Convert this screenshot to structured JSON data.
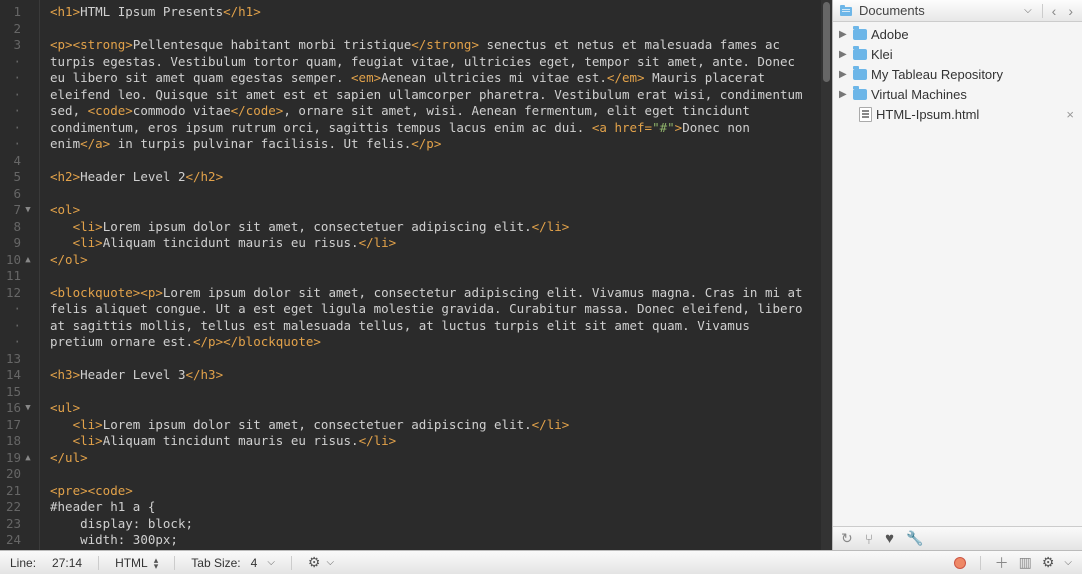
{
  "gutter": [
    {
      "n": "1"
    },
    {
      "n": "2"
    },
    {
      "n": "3"
    },
    {
      "n": "·"
    },
    {
      "n": "·"
    },
    {
      "n": "·"
    },
    {
      "n": "·"
    },
    {
      "n": "·"
    },
    {
      "n": "·"
    },
    {
      "n": "4"
    },
    {
      "n": "5"
    },
    {
      "n": "6"
    },
    {
      "n": "7",
      "mark": "▼"
    },
    {
      "n": "8"
    },
    {
      "n": "9"
    },
    {
      "n": "10",
      "mark": "▲"
    },
    {
      "n": "11"
    },
    {
      "n": "12"
    },
    {
      "n": "·"
    },
    {
      "n": "·"
    },
    {
      "n": "·"
    },
    {
      "n": "13"
    },
    {
      "n": "14"
    },
    {
      "n": "15"
    },
    {
      "n": "16",
      "mark": "▼"
    },
    {
      "n": "17"
    },
    {
      "n": "18"
    },
    {
      "n": "19",
      "mark": "▲"
    },
    {
      "n": "20"
    },
    {
      "n": "21"
    },
    {
      "n": "22"
    },
    {
      "n": "23"
    },
    {
      "n": "24"
    }
  ],
  "code_lines": [
    [
      {
        "c": "tag",
        "t": "<h1>"
      },
      {
        "c": "txt",
        "t": "HTML Ipsum Presents"
      },
      {
        "c": "tag",
        "t": "</h1>"
      }
    ],
    [],
    [
      {
        "c": "tag",
        "t": "<p><strong>"
      },
      {
        "c": "txt",
        "t": "Pellentesque habitant morbi tristique"
      },
      {
        "c": "tag",
        "t": "</strong>"
      },
      {
        "c": "txt",
        "t": " senectus et netus et malesuada fames ac "
      }
    ],
    [
      {
        "c": "txt",
        "t": "turpis egestas. Vestibulum tortor quam, feugiat vitae, ultricies eget, tempor sit amet, ante. Donec "
      }
    ],
    [
      {
        "c": "txt",
        "t": "eu libero sit amet quam egestas semper. "
      },
      {
        "c": "tag",
        "t": "<em>"
      },
      {
        "c": "txt",
        "t": "Aenean ultricies mi vitae est."
      },
      {
        "c": "tag",
        "t": "</em>"
      },
      {
        "c": "txt",
        "t": " Mauris placerat "
      }
    ],
    [
      {
        "c": "txt",
        "t": "eleifend leo. Quisque sit amet est et sapien ullamcorper pharetra. Vestibulum erat wisi, condimentum "
      }
    ],
    [
      {
        "c": "txt",
        "t": "sed, "
      },
      {
        "c": "tag",
        "t": "<code>"
      },
      {
        "c": "txt",
        "t": "commodo vitae"
      },
      {
        "c": "tag",
        "t": "</code>"
      },
      {
        "c": "txt",
        "t": ", ornare sit amet, wisi. Aenean fermentum, elit eget tincidunt "
      }
    ],
    [
      {
        "c": "txt",
        "t": "condimentum, eros ipsum rutrum orci, sagittis tempus lacus enim ac dui. "
      },
      {
        "c": "tag",
        "t": "<a "
      },
      {
        "c": "attr-name",
        "t": "href"
      },
      {
        "c": "tag",
        "t": "="
      },
      {
        "c": "attr-val",
        "t": "\"#\""
      },
      {
        "c": "tag",
        "t": ">"
      },
      {
        "c": "txt",
        "t": "Donec non "
      }
    ],
    [
      {
        "c": "txt",
        "t": "enim"
      },
      {
        "c": "tag",
        "t": "</a>"
      },
      {
        "c": "txt",
        "t": " in turpis pulvinar facilisis. Ut felis."
      },
      {
        "c": "tag",
        "t": "</p>"
      }
    ],
    [],
    [
      {
        "c": "tag",
        "t": "<h2>"
      },
      {
        "c": "txt",
        "t": "Header Level 2"
      },
      {
        "c": "tag",
        "t": "</h2>"
      }
    ],
    [],
    [
      {
        "c": "tag",
        "t": "<ol>"
      }
    ],
    [
      {
        "c": "txt",
        "t": "   "
      },
      {
        "c": "tag",
        "t": "<li>"
      },
      {
        "c": "txt",
        "t": "Lorem ipsum dolor sit amet, consectetuer adipiscing elit."
      },
      {
        "c": "tag",
        "t": "</li>"
      }
    ],
    [
      {
        "c": "txt",
        "t": "   "
      },
      {
        "c": "tag",
        "t": "<li>"
      },
      {
        "c": "txt",
        "t": "Aliquam tincidunt mauris eu risus."
      },
      {
        "c": "tag",
        "t": "</li>"
      }
    ],
    [
      {
        "c": "tag",
        "t": "</ol>"
      }
    ],
    [],
    [
      {
        "c": "tag",
        "t": "<blockquote><p>"
      },
      {
        "c": "txt",
        "t": "Lorem ipsum dolor sit amet, consectetur adipiscing elit. Vivamus magna. Cras in mi at "
      }
    ],
    [
      {
        "c": "txt",
        "t": "felis aliquet congue. Ut a est eget ligula molestie gravida. Curabitur massa. Donec eleifend, libero "
      }
    ],
    [
      {
        "c": "txt",
        "t": "at sagittis mollis, tellus est malesuada tellus, at luctus turpis elit sit amet quam. Vivamus "
      }
    ],
    [
      {
        "c": "txt",
        "t": "pretium ornare est."
      },
      {
        "c": "tag",
        "t": "</p></blockquote>"
      }
    ],
    [],
    [
      {
        "c": "tag",
        "t": "<h3>"
      },
      {
        "c": "txt",
        "t": "Header Level 3"
      },
      {
        "c": "tag",
        "t": "</h3>"
      }
    ],
    [],
    [
      {
        "c": "tag",
        "t": "<ul>"
      }
    ],
    [
      {
        "c": "txt",
        "t": "   "
      },
      {
        "c": "tag",
        "t": "<li>"
      },
      {
        "c": "txt",
        "t": "Lorem ipsum dolor sit amet, consectetuer adipiscing elit."
      },
      {
        "c": "tag",
        "t": "</li>"
      }
    ],
    [
      {
        "c": "txt",
        "t": "   "
      },
      {
        "c": "tag",
        "t": "<li>"
      },
      {
        "c": "txt",
        "t": "Aliquam tincidunt mauris eu risus."
      },
      {
        "c": "tag",
        "t": "</li>"
      }
    ],
    [
      {
        "c": "tag",
        "t": "</ul>"
      }
    ],
    [],
    [
      {
        "c": "tag",
        "t": "<pre><code>"
      }
    ],
    [
      {
        "c": "txt",
        "t": "#header h1 a {"
      }
    ],
    [
      {
        "c": "txt",
        "t": "    display: block;"
      }
    ],
    [
      {
        "c": "txt",
        "t": "    width: 300px;"
      }
    ]
  ],
  "sidebar": {
    "crumb": "Documents",
    "items": [
      {
        "type": "folder",
        "label": "Adobe"
      },
      {
        "type": "folder",
        "label": "Klei"
      },
      {
        "type": "folder",
        "label": "My Tableau Repository"
      },
      {
        "type": "folder",
        "label": "Virtual Machines"
      },
      {
        "type": "file",
        "label": "HTML-Ipsum.html",
        "open": true
      }
    ]
  },
  "status": {
    "line_label": "Line:",
    "line_value": "27:14",
    "language": "HTML",
    "tab_label": "Tab Size:",
    "tab_value": "4"
  }
}
